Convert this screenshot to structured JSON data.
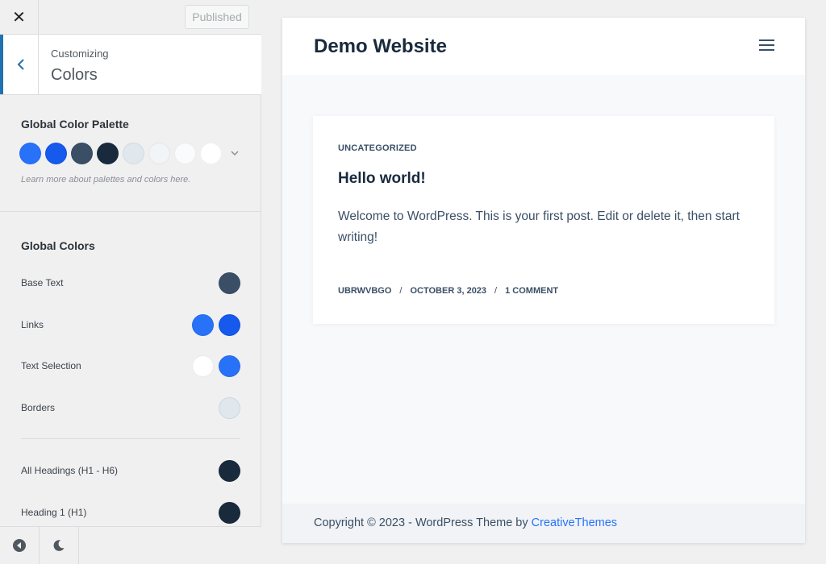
{
  "topbar": {
    "close_glyph": "✕",
    "publish_label": "Published"
  },
  "section": {
    "breadcrumb": "Customizing",
    "title": "Colors"
  },
  "palette": {
    "title": "Global Color Palette",
    "swatches": [
      "#2872fa",
      "#1559ed",
      "#3a4f66",
      "#192a3d",
      "#e1e8ed",
      "#f2f5f7",
      "#fafbfc",
      "#ffffff"
    ],
    "note": "Learn more about palettes and colors here."
  },
  "global_colors": {
    "title": "Global Colors",
    "rows": [
      {
        "label": "Base Text",
        "colors": [
          "#3a4f66"
        ]
      },
      {
        "label": "Links",
        "colors": [
          "#2872fa",
          "#1559ed"
        ]
      },
      {
        "label": "Text Selection",
        "colors": [
          "#ffffff",
          "#2872fa"
        ]
      },
      {
        "label": "Borders",
        "colors": [
          "#e1e8ed"
        ]
      },
      {
        "label": "All Headings (H1 - H6)",
        "colors": [
          "#192a3d"
        ]
      },
      {
        "label": "Heading 1 (H1)",
        "colors": [
          "#192a3d"
        ]
      }
    ]
  },
  "preview": {
    "site_title": "Demo Website",
    "post": {
      "category": "UNCATEGORIZED",
      "title": "Hello world!",
      "excerpt": "Welcome to WordPress. This is your first post. Edit or delete it, then start writing!",
      "author": "UBRWVBGO",
      "date": "OCTOBER 3, 2023",
      "comments": "1 COMMENT",
      "separator": "/"
    },
    "footer": {
      "prefix": "Copyright © 2023 - WordPress Theme by ",
      "link": "CreativeThemes"
    }
  }
}
